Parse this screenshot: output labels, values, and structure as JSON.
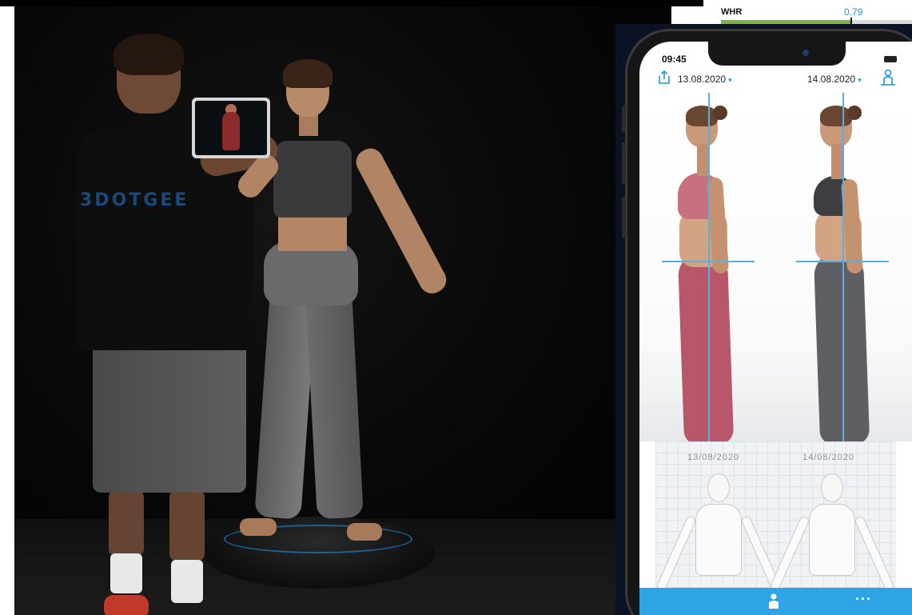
{
  "whr": {
    "label": "WHR",
    "value": "0.79",
    "level_fraction": 0.82
  },
  "photo": {
    "shirt_text": "3DOTGEE"
  },
  "phone": {
    "status_bar": {
      "time": "09:45"
    },
    "header": {
      "date_left": "13.08.2020",
      "date_right": "14.08.2020",
      "caret": "▾"
    },
    "comparison": {
      "date_left": "13/08/2020",
      "date_right": "14/08/2020"
    },
    "tabbar": {
      "more_label": "···"
    }
  },
  "colors": {
    "accent": "#1a9bdc",
    "tabbar": "#2ea3e6",
    "whr_good": "#7cb342",
    "outfit_left": "#b8566a",
    "outfit_right": "#5e5f62"
  },
  "icons": {
    "share": "share-icon",
    "scan": "body-scan-icon",
    "add": "plus-icon",
    "more": "more-icon"
  }
}
